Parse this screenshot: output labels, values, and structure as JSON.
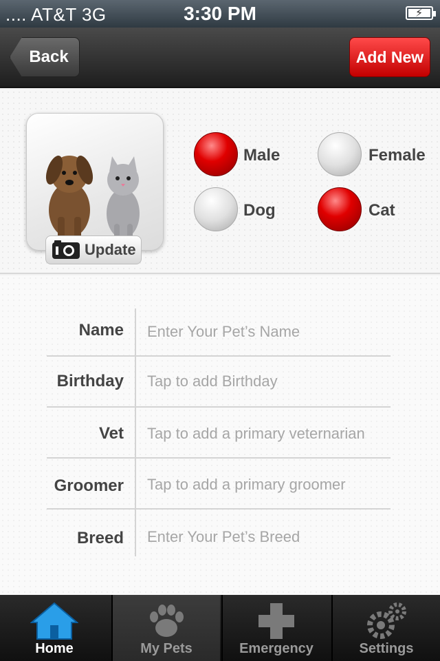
{
  "status_bar": {
    "carrier": ".... AT&T  3G",
    "time": "3:30 PM",
    "battery_icon": "battery-charging-icon"
  },
  "nav": {
    "back_label": "Back",
    "add_new_label": "Add New"
  },
  "pet_panel": {
    "update_label": "Update",
    "options": [
      {
        "label": "Male",
        "selected": true
      },
      {
        "label": "Female",
        "selected": false
      },
      {
        "label": "Dog",
        "selected": false
      },
      {
        "label": "Cat",
        "selected": true
      }
    ]
  },
  "form": {
    "fields": [
      {
        "label": "Name",
        "placeholder": "Enter Your Pet’s Name"
      },
      {
        "label": "Birthday",
        "placeholder": "Tap to add Birthday"
      },
      {
        "label": "Vet",
        "placeholder": "Tap to add a primary veternarian"
      },
      {
        "label": "Groomer",
        "placeholder": "Tap to add a primary groomer"
      },
      {
        "label": "Breed",
        "placeholder": "Enter Your Pet’s Breed"
      }
    ]
  },
  "tabbar": {
    "tabs": [
      {
        "label": "Home",
        "icon": "home-icon"
      },
      {
        "label": "My Pets",
        "icon": "paw-icon"
      },
      {
        "label": "Emergency",
        "icon": "cross-icon"
      },
      {
        "label": "Settings",
        "icon": "gears-icon"
      }
    ]
  },
  "colors": {
    "accent_red": "#d40000",
    "home_blue": "#2a9ee8"
  }
}
